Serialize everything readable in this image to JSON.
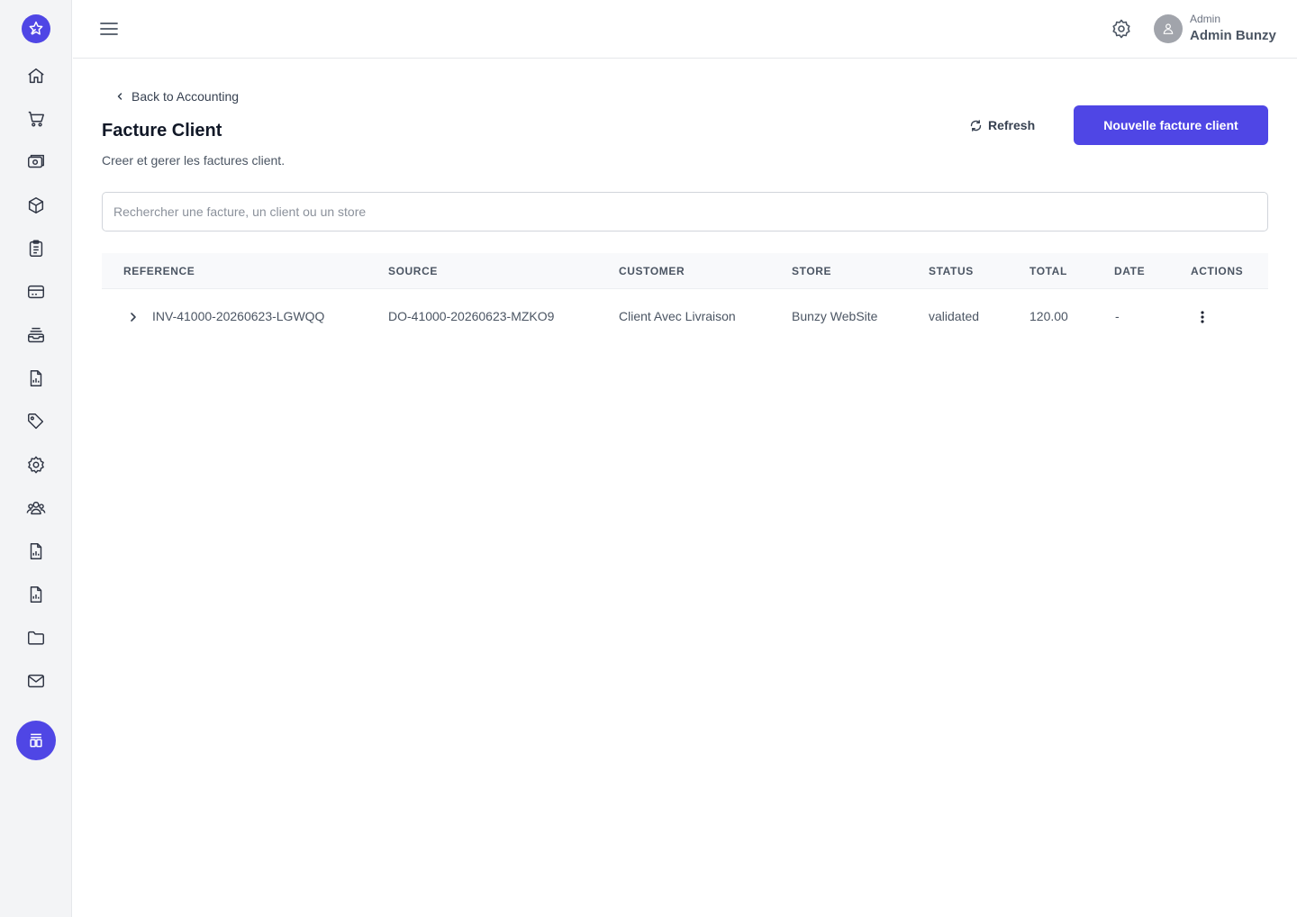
{
  "header": {
    "user_role": "Admin",
    "user_name": "Admin Bunzy"
  },
  "sidebar": {
    "items": [
      "home-icon",
      "cart-icon",
      "camera-icon",
      "box-icon",
      "clipboard-icon",
      "card-icon",
      "inbox-icon",
      "report-icon",
      "tag-icon",
      "settings-icon",
      "users-icon",
      "report-icon",
      "report-icon",
      "folder-icon",
      "mail-icon"
    ]
  },
  "page": {
    "back_label": "Back to Accounting",
    "title": "Facture Client",
    "subtitle": "Creer et gerer les factures client.",
    "refresh_label": "Refresh",
    "new_button_label": "Nouvelle facture client",
    "search_placeholder": "Rechercher une facture, un client ou un store"
  },
  "table": {
    "columns": [
      "REFERENCE",
      "SOURCE",
      "CUSTOMER",
      "STORE",
      "STATUS",
      "TOTAL",
      "DATE",
      "ACTIONS"
    ],
    "rows": [
      {
        "reference": "INV-41000-20260623-LGWQQ",
        "source": "DO-41000-20260623-MZKO9",
        "customer": "Client Avec Livraison",
        "store": "Bunzy WebSite",
        "status": "validated",
        "total": "120.00",
        "date": "-"
      }
    ]
  },
  "colors": {
    "accent": "#4f46e5",
    "sidebar_bg": "#f3f4f6"
  }
}
